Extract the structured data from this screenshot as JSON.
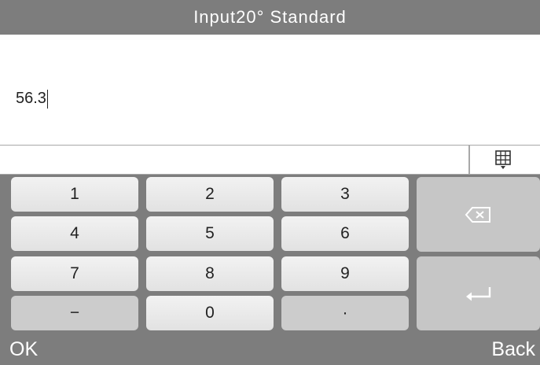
{
  "title": "Input20° Standard",
  "input": {
    "value": "56.3"
  },
  "candidate_bar": {
    "ime_icon": "keyboard-grid-icon"
  },
  "keypad": {
    "keys": [
      "1",
      "2",
      "3",
      "4",
      "5",
      "6",
      "7",
      "8",
      "9",
      "−",
      "0",
      "·"
    ],
    "backspace_icon": "backspace-icon",
    "enter_icon": "enter-icon"
  },
  "softkeys": {
    "left": "OK",
    "right": "Back"
  },
  "colors": {
    "bar": "#7d7d7d",
    "key": "#eaeaea",
    "key_dark": "#cccccc",
    "side_key": "#c6c6c6"
  }
}
